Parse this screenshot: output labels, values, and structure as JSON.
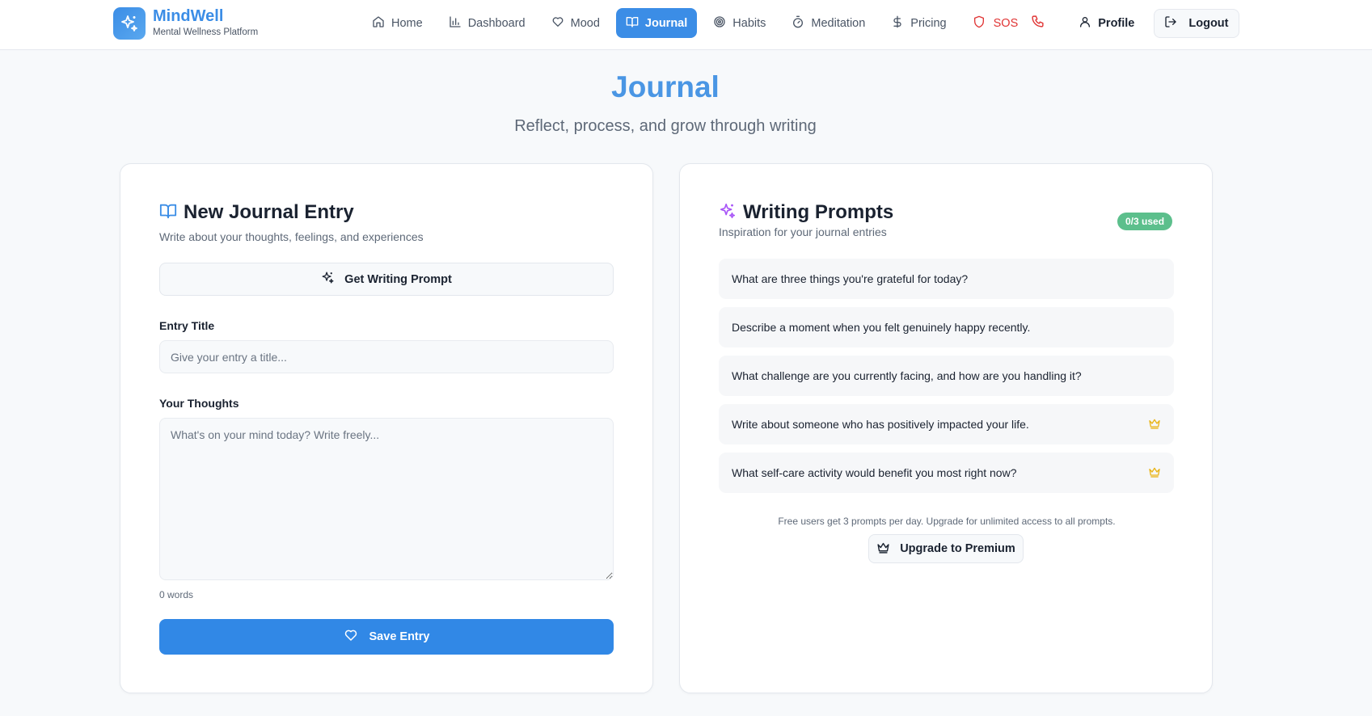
{
  "brand": {
    "name": "MindWell",
    "subtitle": "Mental Wellness Platform",
    "logo_icon": "sparkles-icon"
  },
  "nav": {
    "items": [
      {
        "label": "Home",
        "icon": "home-icon"
      },
      {
        "label": "Dashboard",
        "icon": "bar-chart-icon"
      },
      {
        "label": "Mood",
        "icon": "heart-icon"
      },
      {
        "label": "Journal",
        "icon": "book-open-icon",
        "active": true
      },
      {
        "label": "Habits",
        "icon": "target-icon"
      },
      {
        "label": "Meditation",
        "icon": "timer-icon"
      },
      {
        "label": "Pricing",
        "icon": "dollar-icon"
      }
    ],
    "sos_label": "SOS",
    "profile_label": "Profile",
    "logout_label": "Logout"
  },
  "page": {
    "title": "Journal",
    "subtitle": "Reflect, process, and grow through writing"
  },
  "entry": {
    "title": "New Journal Entry",
    "description": "Write about your thoughts, feelings, and experiences",
    "prompt_button": "Get Writing Prompt",
    "title_label": "Entry Title",
    "title_value": "",
    "title_placeholder": "Give your entry a title...",
    "thoughts_label": "Your Thoughts",
    "thoughts_value": "",
    "thoughts_placeholder": "What's on your mind today? Write freely...",
    "word_count": "0 words",
    "save_button": "Save Entry"
  },
  "prompts": {
    "title": "Writing Prompts",
    "description": "Inspiration for your journal entries",
    "usage_badge": "0/3 used",
    "items": [
      {
        "text": "What are three things you're grateful for today?",
        "premium": false
      },
      {
        "text": "Describe a moment when you felt genuinely happy recently.",
        "premium": false
      },
      {
        "text": "What challenge are you currently facing, and how are you handling it?",
        "premium": false
      },
      {
        "text": "Write about someone who has positively impacted your life.",
        "premium": true
      },
      {
        "text": "What self-care activity would benefit you most right now?",
        "premium": true
      }
    ],
    "footnote": "Free users get 3 prompts per day. Upgrade for unlimited access to all prompts.",
    "upgrade_button": "Upgrade to Premium"
  },
  "colors": {
    "accent": "#3b8de6",
    "primary_button": "#3188e6",
    "badge": "#5cbf8c",
    "sos": "#e03434",
    "premium_crown": "#e9b416",
    "prompt_sparkle": "#a855f7"
  }
}
